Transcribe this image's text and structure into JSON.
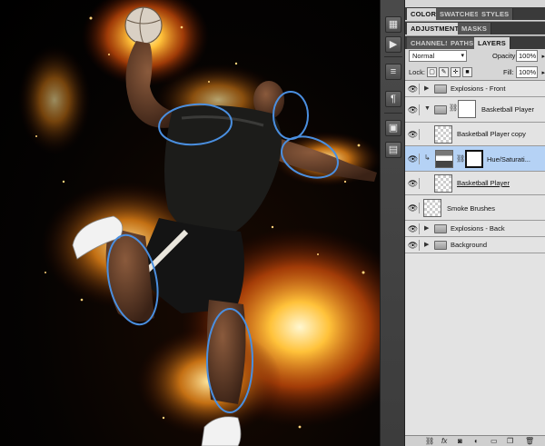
{
  "panel_top": {
    "tabs": [
      {
        "label": "COLOR",
        "active": true
      },
      {
        "label": "SWATCHES",
        "active": false
      },
      {
        "label": "STYLES",
        "active": false
      }
    ]
  },
  "panel_mid": {
    "tabs": [
      {
        "label": "ADJUSTMENTS",
        "active": true
      },
      {
        "label": "MASKS",
        "active": false
      }
    ]
  },
  "panel_layers": {
    "tabs": [
      {
        "label": "CHANNELS",
        "active": false
      },
      {
        "label": "PATHS",
        "active": false
      },
      {
        "label": "LAYERS",
        "active": true
      }
    ],
    "blend_mode": "Normal",
    "opacity_label": "Opacity:",
    "opacity_value": "100%",
    "lock_label": "Lock:",
    "fill_label": "Fill:",
    "fill_value": "100%",
    "layers": [
      {
        "name": "Explosions - Front",
        "kind": "group",
        "expanded": false,
        "visible": true
      },
      {
        "name": "Basketball Player",
        "kind": "group",
        "expanded": true,
        "visible": true
      },
      {
        "name": "Basketball Player copy",
        "kind": "layer",
        "visible": true
      },
      {
        "name": "Hue/Saturati...",
        "kind": "adjustment",
        "visible": true,
        "selected": true,
        "clipped": true
      },
      {
        "name": "Basketball Player",
        "kind": "layer",
        "visible": true,
        "underlined": true
      },
      {
        "name": "Smoke Brushes",
        "kind": "layer",
        "visible": true
      },
      {
        "name": "Explosions - Back",
        "kind": "group",
        "expanded": false,
        "visible": true
      },
      {
        "name": "Background",
        "kind": "group",
        "expanded": false,
        "visible": true
      }
    ]
  },
  "colors": {
    "selection_highlight": "#b5d2f5",
    "annotation_circle": "#4a8fe0",
    "panel_background": "#d6d6d6"
  },
  "icons": {
    "visibility": "eye-icon",
    "group": "folder-icon",
    "link": "chain-icon",
    "lock": "lock-icon"
  }
}
